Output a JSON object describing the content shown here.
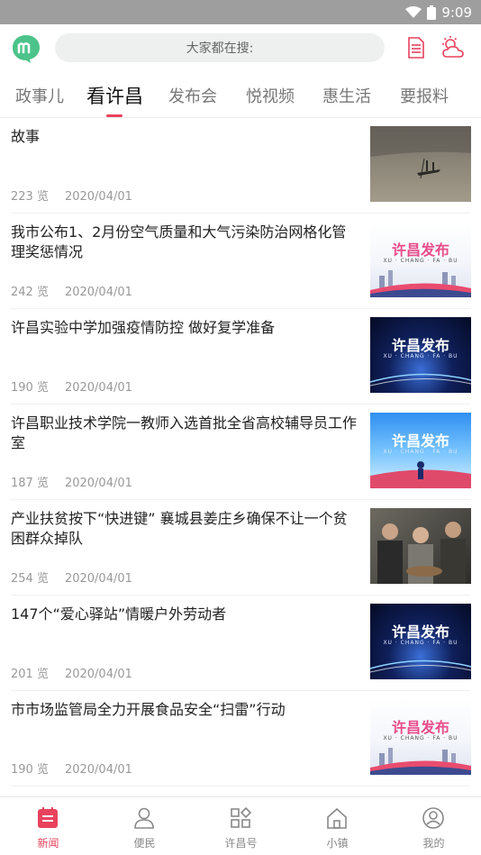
{
  "status_bar": {
    "time": "9:09"
  },
  "search": {
    "placeholder_text": "大家都在搜:"
  },
  "tabs": [
    {
      "label": "政事儿",
      "active": false
    },
    {
      "label": "看许昌",
      "active": true
    },
    {
      "label": "发布会",
      "active": false
    },
    {
      "label": "悦视频",
      "active": false
    },
    {
      "label": "惠生活",
      "active": false
    },
    {
      "label": "要报料",
      "active": false
    }
  ],
  "news": [
    {
      "title": "故事",
      "views": "223 览",
      "date": "2020/04/01",
      "thumb": "photo-lake"
    },
    {
      "title": "我市公布1、2月份空气质量和大气污染防治网格化管理奖惩情况",
      "views": "242 览",
      "date": "2020/04/01",
      "thumb": "brand-light"
    },
    {
      "title": "许昌实验中学加强疫情防控 做好复学准备",
      "views": "190 览",
      "date": "2020/04/01",
      "thumb": "brand-dark"
    },
    {
      "title": "许昌职业技术学院一教师入选首批全省高校辅导员工作室",
      "views": "187 览",
      "date": "2020/04/01",
      "thumb": "brand-blue"
    },
    {
      "title": "产业扶贫按下“快进键” 襄城县姜庄乡确保不让一个贫困群众掉队",
      "views": "254 览",
      "date": "2020/04/01",
      "thumb": "photo-people"
    },
    {
      "title": "147个“爱心驿站”情暖户外劳动者",
      "views": "201 览",
      "date": "2020/04/01",
      "thumb": "brand-dark"
    },
    {
      "title": "市市场监管局全力开展食品安全“扫雷”行动",
      "views": "190 览",
      "date": "2020/04/01",
      "thumb": "brand-light"
    }
  ],
  "thumb_text": {
    "brand": "许昌发布",
    "sub": "XU · CHANG · FA · BU"
  },
  "bottom_nav": [
    {
      "label": "新闻",
      "icon": "news-icon",
      "active": true
    },
    {
      "label": "便民",
      "icon": "person-icon",
      "active": false
    },
    {
      "label": "许昌号",
      "icon": "apps-icon",
      "active": false
    },
    {
      "label": "小镇",
      "icon": "home-icon",
      "active": false
    },
    {
      "label": "我的",
      "icon": "profile-icon",
      "active": false
    }
  ],
  "colors": {
    "accent": "#e8425d",
    "logo": "#4cc38a",
    "status_bar": "#9e9e9e"
  }
}
